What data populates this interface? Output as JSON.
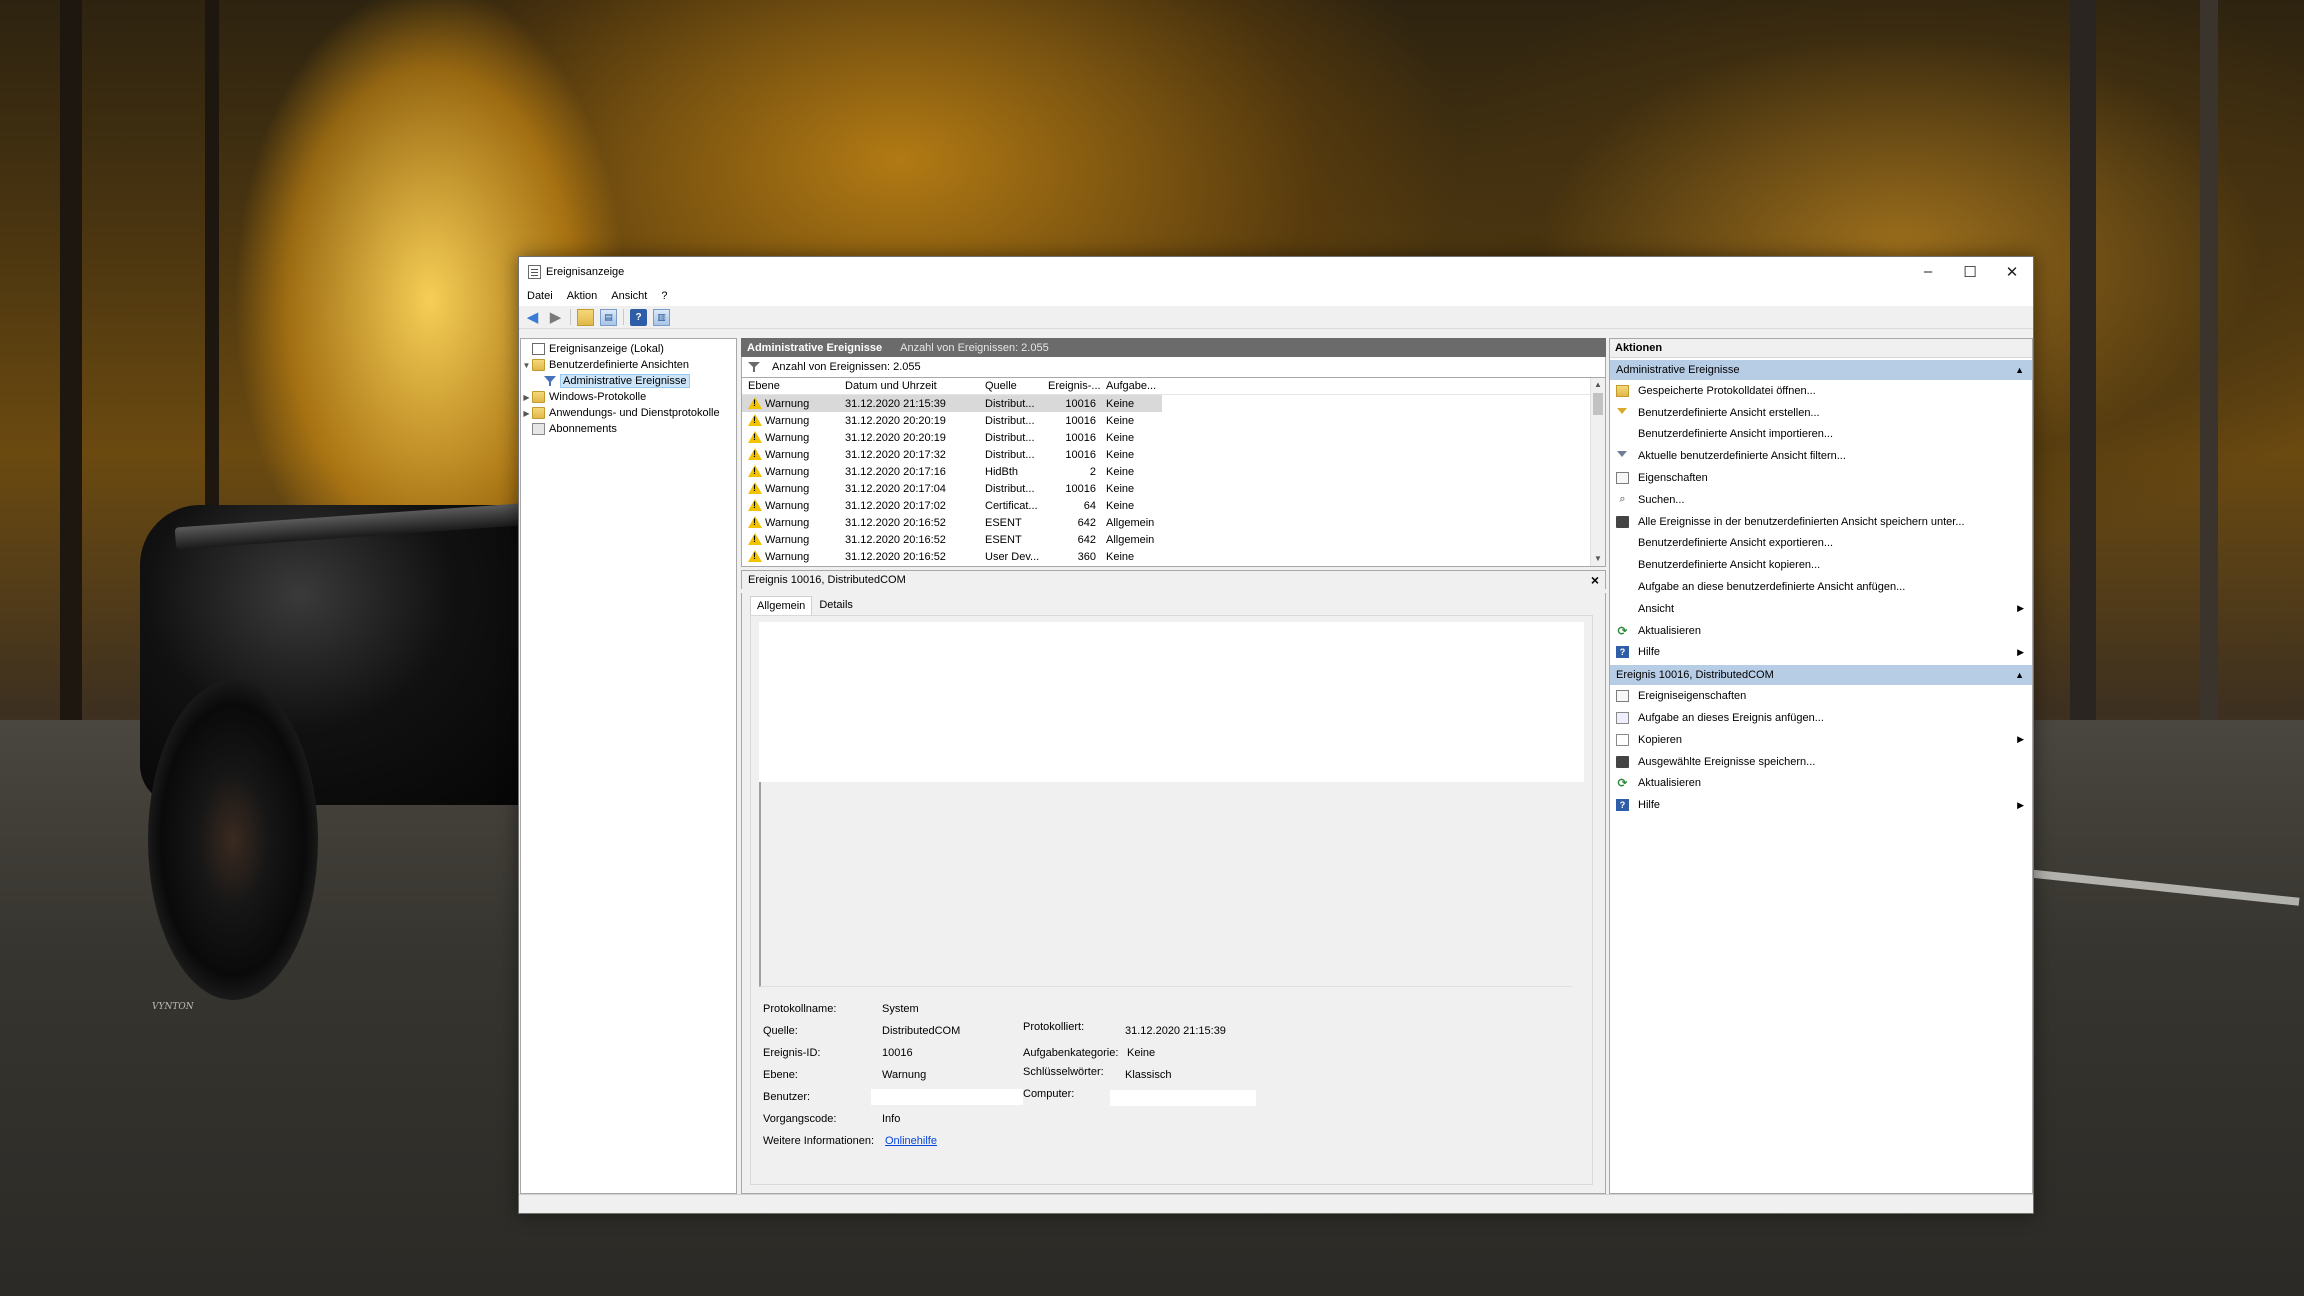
{
  "window": {
    "title": "Ereignisanzeige",
    "controls": {
      "minimize": "–",
      "maximize": "☐",
      "close": "✕"
    }
  },
  "menu": [
    "Datei",
    "Aktion",
    "Ansicht",
    "?"
  ],
  "tree": {
    "root": "Ereignisanzeige (Lokal)",
    "custom_views": "Benutzerdefinierte Ansichten",
    "admin_events": "Administrative Ereignisse",
    "windows_logs": "Windows-Protokolle",
    "app_logs": "Anwendungs- und Dienstprotokolle",
    "subscriptions": "Abonnements"
  },
  "center": {
    "header_title": "Administrative Ereignisse",
    "header_count": "Anzahl von Ereignissen: 2.055",
    "filter_text": "Anzahl von Ereignissen: 2.055",
    "columns": [
      "Ebene",
      "Datum und Uhrzeit",
      "Quelle",
      "Ereignis-...",
      "Aufgabe..."
    ],
    "rows": [
      {
        "level": "Warnung",
        "date": "31.12.2020 21:15:39",
        "source": "Distribut...",
        "id": "10016",
        "task": "Keine"
      },
      {
        "level": "Warnung",
        "date": "31.12.2020 20:20:19",
        "source": "Distribut...",
        "id": "10016",
        "task": "Keine"
      },
      {
        "level": "Warnung",
        "date": "31.12.2020 20:20:19",
        "source": "Distribut...",
        "id": "10016",
        "task": "Keine"
      },
      {
        "level": "Warnung",
        "date": "31.12.2020 20:17:32",
        "source": "Distribut...",
        "id": "10016",
        "task": "Keine"
      },
      {
        "level": "Warnung",
        "date": "31.12.2020 20:17:16",
        "source": "HidBth",
        "id": "2",
        "task": "Keine"
      },
      {
        "level": "Warnung",
        "date": "31.12.2020 20:17:04",
        "source": "Distribut...",
        "id": "10016",
        "task": "Keine"
      },
      {
        "level": "Warnung",
        "date": "31.12.2020 20:17:02",
        "source": "Certificat...",
        "id": "64",
        "task": "Keine"
      },
      {
        "level": "Warnung",
        "date": "31.12.2020 20:16:52",
        "source": "ESENT",
        "id": "642",
        "task": "Allgemein"
      },
      {
        "level": "Warnung",
        "date": "31.12.2020 20:16:52",
        "source": "ESENT",
        "id": "642",
        "task": "Allgemein"
      },
      {
        "level": "Warnung",
        "date": "31.12.2020 20:16:52",
        "source": "User Dev...",
        "id": "360",
        "task": "Keine"
      }
    ]
  },
  "detail": {
    "title": "Ereignis 10016, DistributedCOM",
    "tabs": [
      "Allgemein",
      "Details"
    ],
    "fields": {
      "log_name_label": "Protokollname:",
      "log_name": "System",
      "source_label": "Quelle:",
      "source": "DistributedCOM",
      "logged_label": "Protokolliert:",
      "logged": "31.12.2020 21:15:39",
      "event_id_label": "Ereignis-ID:",
      "event_id": "10016",
      "task_cat_label": "Aufgabenkategorie:",
      "task_cat": "Keine",
      "level_label": "Ebene:",
      "level": "Warnung",
      "keywords_label": "Schlüsselwörter:",
      "keywords": "Klassisch",
      "user_label": "Benutzer:",
      "computer_label": "Computer:",
      "opcode_label": "Vorgangscode:",
      "opcode": "Info",
      "more_info_label": "Weitere Informationen:",
      "more_info_link": "Onlinehilfe"
    }
  },
  "actions": {
    "title": "Aktionen",
    "section1": "Administrative Ereignisse",
    "items1": [
      "Gespeicherte Protokolldatei öffnen...",
      "Benutzerdefinierte Ansicht erstellen...",
      "Benutzerdefinierte Ansicht importieren...",
      "Aktuelle benutzerdefinierte Ansicht filtern...",
      "Eigenschaften",
      "Suchen...",
      "Alle Ereignisse in der benutzerdefinierten Ansicht speichern unter...",
      "Benutzerdefinierte Ansicht exportieren...",
      "Benutzerdefinierte Ansicht kopieren...",
      "Aufgabe an diese benutzerdefinierte Ansicht anfügen...",
      "Ansicht",
      "Aktualisieren",
      "Hilfe"
    ],
    "section2": "Ereignis 10016, DistributedCOM",
    "items2": [
      "Ereigniseigenschaften",
      "Aufgabe an dieses Ereignis anfügen...",
      "Kopieren",
      "Ausgewählte Ereignisse speichern...",
      "Aktualisieren",
      "Hilfe"
    ]
  },
  "wallpaper": {
    "signature": "VYNTON"
  },
  "colors": {
    "section_blue": "#b7cde6",
    "header_gray": "#6b6b6b",
    "warning_yellow": "#f3c200",
    "link_blue": "#0645d9"
  }
}
